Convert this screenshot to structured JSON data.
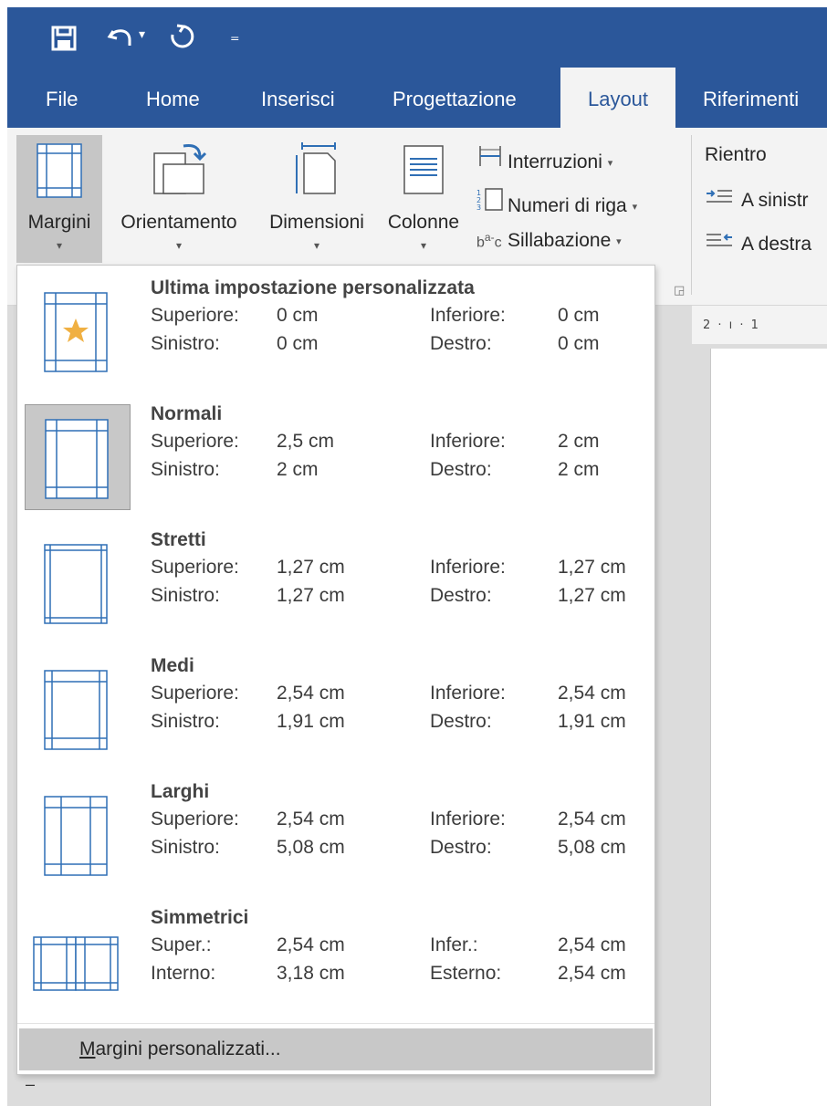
{
  "colors": {
    "accent": "#2b579a",
    "ribbon": "#f3f3f3",
    "selected": "#c8c8c8",
    "thumb_line": "#2f6fb5",
    "star": "#f0b042"
  },
  "qat": {
    "save_icon": "save-icon",
    "undo_icon": "undo-icon",
    "redo_icon": "redo-icon",
    "customize_icon": "customize-qat-icon"
  },
  "tabs": [
    {
      "label": "File"
    },
    {
      "label": "Home"
    },
    {
      "label": "Inserisci"
    },
    {
      "label": "Progettazione"
    },
    {
      "label": "Layout",
      "active": true
    },
    {
      "label": "Riferimenti"
    }
  ],
  "ribbon": {
    "margini": "Margini",
    "orientamento": "Orientamento",
    "dimensioni": "Dimensioni",
    "colonne": "Colonne",
    "interruzioni": "Interruzioni",
    "numeri_riga": "Numeri di riga",
    "sillabazione": "Sillabazione",
    "rientro": "Rientro",
    "a_sinistra": "A sinistr",
    "a_destra": "A destra",
    "ruler_text": "2 · ı · 1"
  },
  "margins_menu": {
    "options": [
      {
        "title": "Ultima impostazione personalizzata",
        "rows": [
          [
            "Superiore:",
            "0 cm",
            "Inferiore:",
            "0 cm"
          ],
          [
            "Sinistro:",
            "0 cm",
            "Destro:",
            "0 cm"
          ]
        ]
      },
      {
        "title": "Normali",
        "selected": true,
        "rows": [
          [
            "Superiore:",
            "2,5 cm",
            "Inferiore:",
            "2 cm"
          ],
          [
            "Sinistro:",
            "2 cm",
            "Destro:",
            "2 cm"
          ]
        ]
      },
      {
        "title": "Stretti",
        "rows": [
          [
            "Superiore:",
            "1,27 cm",
            "Inferiore:",
            "1,27 cm"
          ],
          [
            "Sinistro:",
            "1,27 cm",
            "Destro:",
            "1,27 cm"
          ]
        ]
      },
      {
        "title": "Medi",
        "rows": [
          [
            "Superiore:",
            "2,54 cm",
            "Inferiore:",
            "2,54 cm"
          ],
          [
            "Sinistro:",
            "1,91 cm",
            "Destro:",
            "1,91 cm"
          ]
        ]
      },
      {
        "title": "Larghi",
        "rows": [
          [
            "Superiore:",
            "2,54 cm",
            "Inferiore:",
            "2,54 cm"
          ],
          [
            "Sinistro:",
            "5,08 cm",
            "Destro:",
            "5,08 cm"
          ]
        ]
      },
      {
        "title": "Simmetrici",
        "rows": [
          [
            "Super.:",
            "2,54 cm",
            "Infer.:",
            "2,54 cm"
          ],
          [
            "Interno:",
            "3,18 cm",
            "Esterno:",
            "2,54 cm"
          ]
        ]
      }
    ],
    "custom_mnemonic": "M",
    "custom_rest": "argini personalizzati..."
  },
  "bottom_mark": "–"
}
